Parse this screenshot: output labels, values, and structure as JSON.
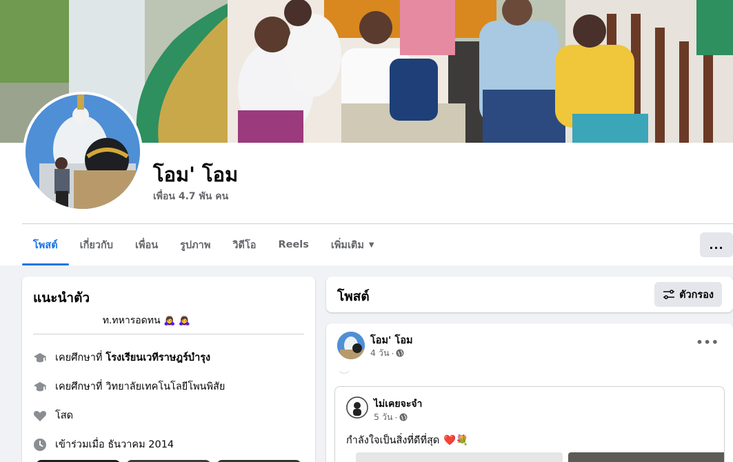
{
  "profile": {
    "name": "โอม' โอม",
    "friends": "เพื่อน 4.7 พัน คน"
  },
  "tabs": [
    {
      "label": "โพสต์",
      "active": true
    },
    {
      "label": "เกี่ยวกับ",
      "active": false
    },
    {
      "label": "เพื่อน",
      "active": false
    },
    {
      "label": "รูปภาพ",
      "active": false
    },
    {
      "label": "วิดีโอ",
      "active": false
    },
    {
      "label": "Reels",
      "active": false
    },
    {
      "label": "เพิ่มเติม",
      "active": false
    }
  ],
  "more_menu_label": "...",
  "intro": {
    "title": "แนะนำตัว",
    "bio": "ท.ทหารอดทน 🙇‍♀️ 🙇‍♀️",
    "items": [
      {
        "icon": "graduation-cap-icon",
        "prefix": "เคยศึกษาที่",
        "value": "โรงเรียนเวทีราษฎร์บำรุง",
        "bold": true
      },
      {
        "icon": "graduation-cap-icon",
        "prefix": "เคยศึกษาที่",
        "value": "วิทยาลัยเทคโนโลยีโพนพิสัย",
        "bold": false
      },
      {
        "icon": "heart-icon",
        "prefix": "โสด",
        "value": "",
        "bold": false
      },
      {
        "icon": "clock-icon",
        "prefix": "เข้าร่วมเมื่อ ธันวาคม 2014",
        "value": "",
        "bold": false
      }
    ]
  },
  "posts": {
    "title": "โพสต์",
    "filter_label": "ตัวกรอง"
  },
  "post": {
    "author": "โอม' โอม",
    "time": "4 วัน",
    "shared": {
      "author": "ไม่เคยจะจำ",
      "time": "5 วัน",
      "text": "กำลังใจเป็นสิ่งที่ดีที่สุด",
      "emoji": "❤️💐"
    }
  },
  "colors": {
    "accent": "#1b74e4",
    "secondary_text": "#65676b",
    "background": "#f0f2f5"
  }
}
